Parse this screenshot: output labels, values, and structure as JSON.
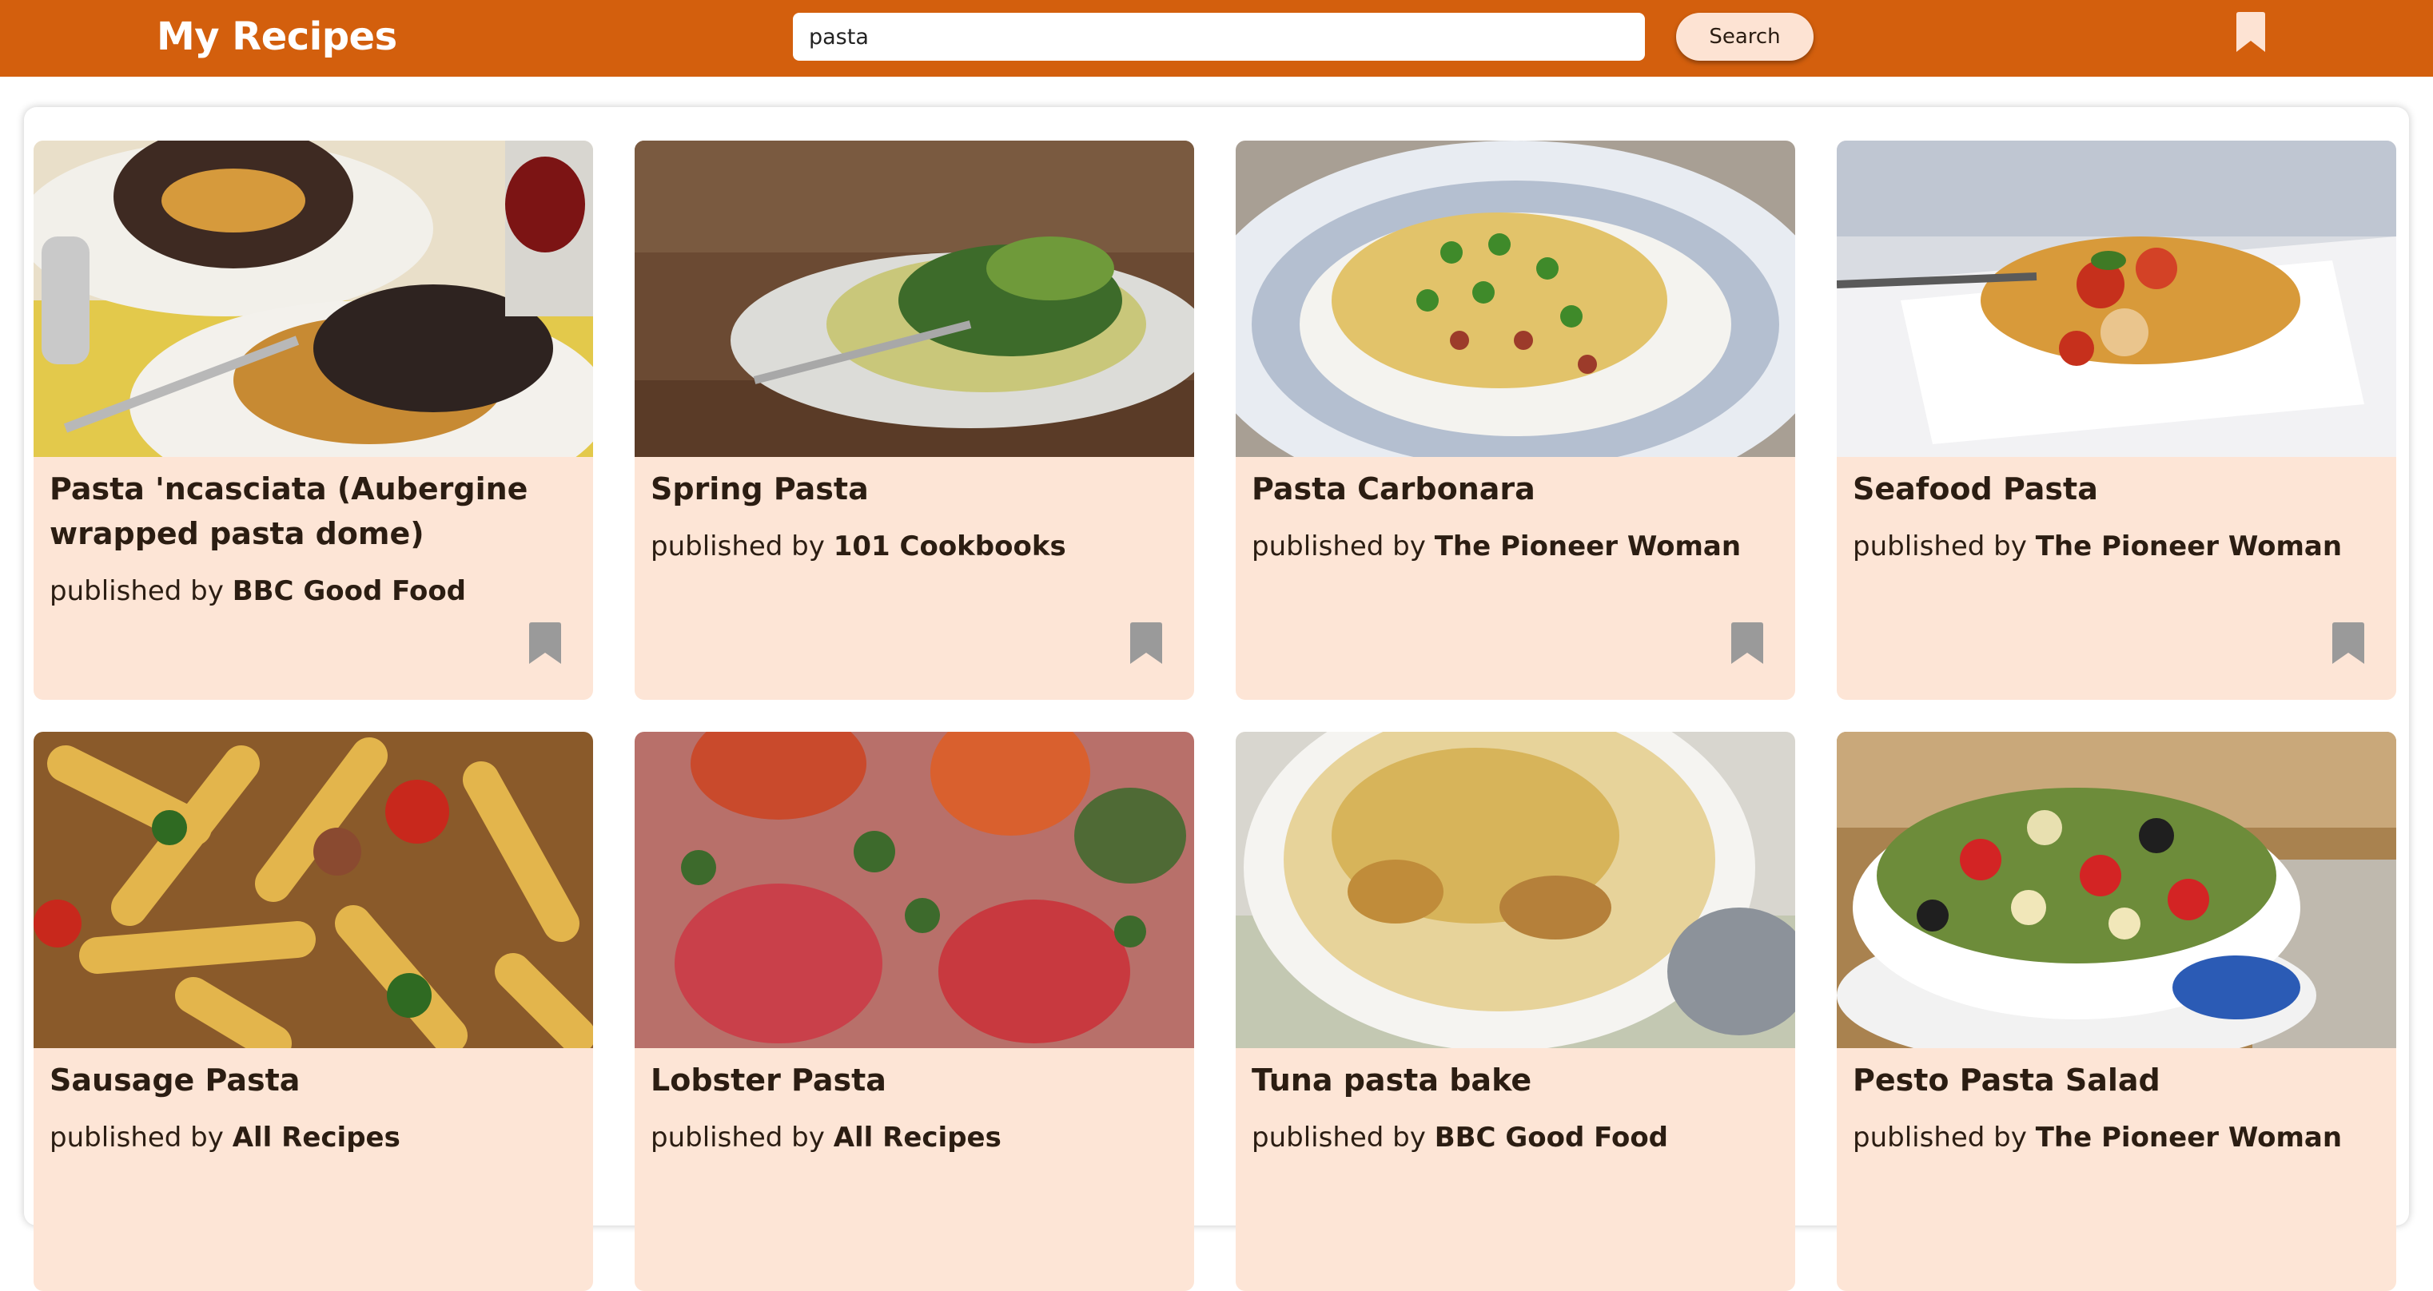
{
  "header": {
    "title": "My Recipes",
    "search_value": "pasta",
    "search_button_label": "Search",
    "bookmarks_icon": "bookmark-icon"
  },
  "colors": {
    "header_bg": "#d35f0d",
    "card_bg": "#fde5d6",
    "button_bg": "#fde3d3",
    "bookmark_inactive": "#9a9a9a",
    "bookmark_header": "#fde3d3"
  },
  "recipes": [
    {
      "title": "Pasta 'ncasciata (Aubergine wrapped pasta dome)",
      "published_by_label": "published by",
      "publisher": "BBC Good Food",
      "bookmark_icon": "bookmark-icon"
    },
    {
      "title": "Spring Pasta",
      "published_by_label": "published by",
      "publisher": "101 Cookbooks",
      "bookmark_icon": "bookmark-icon"
    },
    {
      "title": "Pasta Carbonara",
      "published_by_label": "published by",
      "publisher": "The Pioneer Woman",
      "bookmark_icon": "bookmark-icon"
    },
    {
      "title": "Seafood Pasta",
      "published_by_label": "published by",
      "publisher": "The Pioneer Woman",
      "bookmark_icon": "bookmark-icon"
    },
    {
      "title": "Sausage Pasta",
      "published_by_label": "published by",
      "publisher": "All Recipes",
      "bookmark_icon": "bookmark-icon"
    },
    {
      "title": "Lobster Pasta",
      "published_by_label": "published by",
      "publisher": "All Recipes",
      "bookmark_icon": "bookmark-icon"
    },
    {
      "title": "Tuna pasta bake",
      "published_by_label": "published by",
      "publisher": "BBC Good Food",
      "bookmark_icon": "bookmark-icon"
    },
    {
      "title": "Pesto Pasta Salad",
      "published_by_label": "published by",
      "publisher": "The Pioneer Woman",
      "bookmark_icon": "bookmark-icon"
    }
  ]
}
